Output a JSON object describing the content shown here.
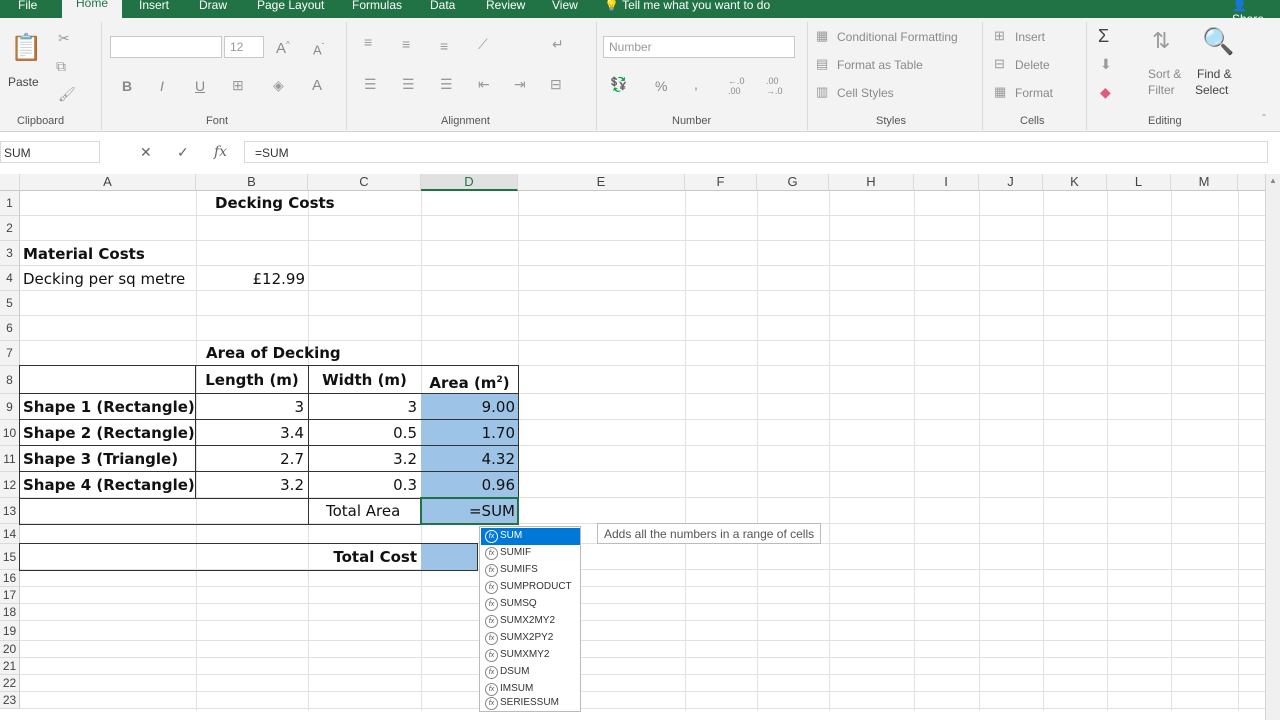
{
  "tabs": {
    "file": "File",
    "home": "Home",
    "insert": "Insert",
    "draw": "Draw",
    "page_layout": "Page Layout",
    "formulas": "Formulas",
    "data": "Data",
    "review": "Review",
    "view": "View",
    "tell_me": "Tell me what you want to do",
    "share": "Share"
  },
  "ribbon": {
    "clipboard": {
      "paste": "Paste",
      "label": "Clipboard"
    },
    "font": {
      "size": "12",
      "label": "Font",
      "bold": "B",
      "italic": "I",
      "underline": "U"
    },
    "alignment": {
      "label": "Alignment"
    },
    "number": {
      "format": "Number",
      "label": "Number"
    },
    "styles": {
      "conditional": "Conditional Formatting",
      "format_table": "Format as Table",
      "cell_styles": "Cell Styles",
      "label": "Styles"
    },
    "cells": {
      "insert": "Insert",
      "delete": "Delete",
      "format": "Format",
      "label": "Cells"
    },
    "editing": {
      "sort_filter_1": "Sort &",
      "sort_filter_2": "Filter",
      "find_select_1": "Find &",
      "find_select_2": "Select",
      "label": "Editing"
    }
  },
  "formula_bar": {
    "name_box": "SUM",
    "formula": "=SUM"
  },
  "columns": [
    "A",
    "B",
    "C",
    "D",
    "E",
    "F",
    "G",
    "H",
    "I",
    "J",
    "K",
    "L",
    "M"
  ],
  "rows": [
    "1",
    "2",
    "3",
    "4",
    "5",
    "6",
    "7",
    "8",
    "9",
    "10",
    "11",
    "12",
    "13",
    "14",
    "15",
    "16",
    "17",
    "18",
    "19",
    "20",
    "21",
    "22",
    "23"
  ],
  "sheet": {
    "title": "Decking Costs",
    "material_heading": "Material Costs",
    "decking_label": "Decking per sq metre",
    "decking_price": "£12.99",
    "area_heading": "Area of Decking",
    "headers": {
      "length": "Length (m)",
      "width": "Width (m)",
      "area": "Area (m",
      "area_sup": "2",
      "area_close": ")"
    },
    "shapes": [
      {
        "name": "Shape 1 (Rectangle)",
        "length": "3",
        "width": "3",
        "area": "9.00"
      },
      {
        "name": "Shape 2 (Rectangle)",
        "length": "3.4",
        "width": "0.5",
        "area": "1.70"
      },
      {
        "name": "Shape 3 (Triangle)",
        "length": "2.7",
        "width": "3.2",
        "area": "4.32"
      },
      {
        "name": "Shape 4 (Rectangle)",
        "length": "3.2",
        "width": "0.3",
        "area": "0.96"
      }
    ],
    "total_area_label": "Total Area",
    "total_area_input": "=SUM",
    "total_cost_label": "Total Cost"
  },
  "autocomplete": {
    "items": [
      "SUM",
      "SUMIF",
      "SUMIFS",
      "SUMPRODUCT",
      "SUMSQ",
      "SUMX2MY2",
      "SUMX2PY2",
      "SUMXMY2",
      "DSUM",
      "IMSUM",
      "SERIESSUM"
    ],
    "tooltip": "Adds all the numbers in a range of cells"
  }
}
